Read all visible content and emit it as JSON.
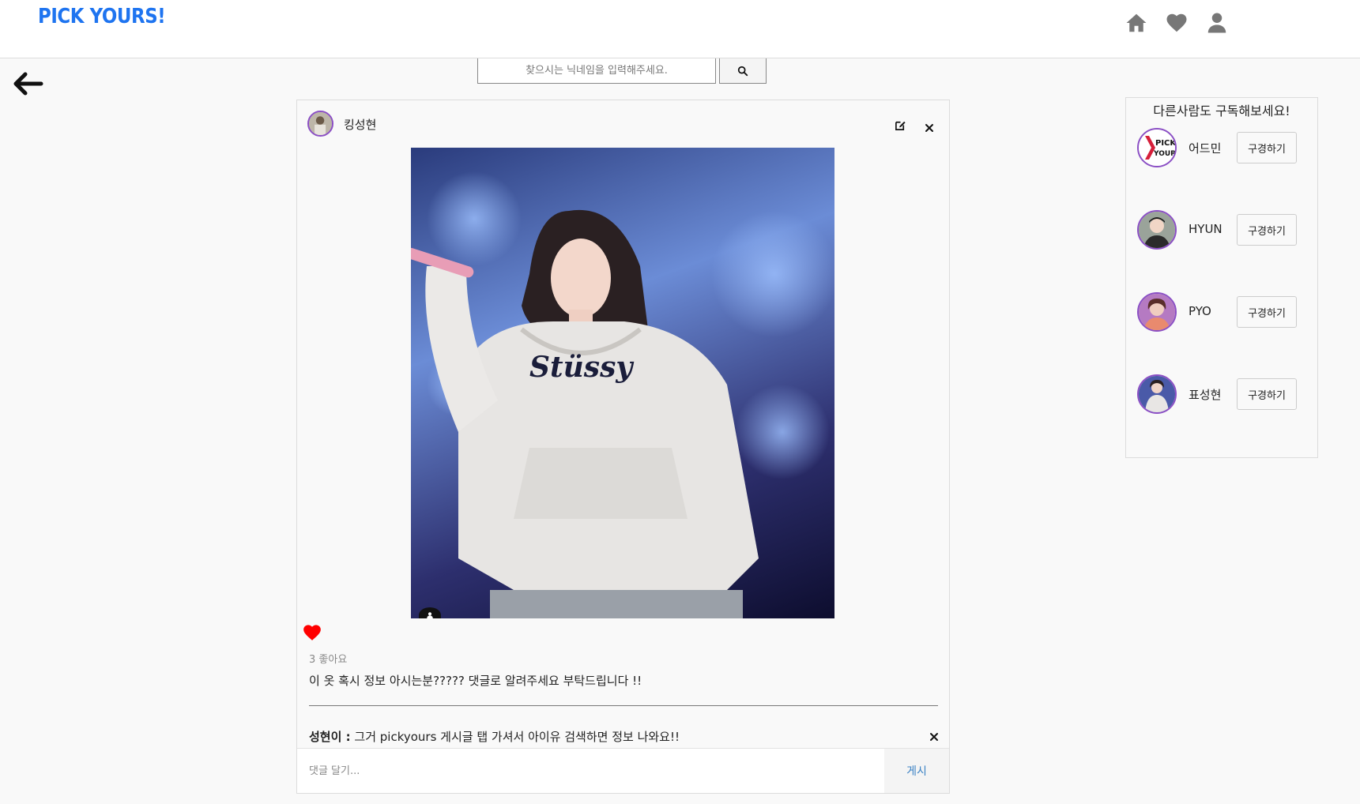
{
  "header": {
    "logo": "PICK YOURS!",
    "nav": [
      {
        "icon": "home-icon"
      },
      {
        "icon": "heart-icon"
      },
      {
        "icon": "user-icon"
      }
    ]
  },
  "search": {
    "placeholder": "찾으시는 닉네임을 입력해주세요.",
    "button_icon": "search-icon"
  },
  "post": {
    "author": "킹성현",
    "image_alt": "아이유 후드티 사진",
    "likes_text": "3 좋아요",
    "caption": "이 옷 혹시 정보 아시는분????? 댓글로 알려주세요 부탁드립니다 !!",
    "comments": [
      {
        "author": "성현이 :",
        "text": " 그거 pickyours 게시글 탭 가셔서 아이유 검색하면 정보 나와요!!"
      }
    ],
    "comment_placeholder": "댓글 달기...",
    "post_button": "게시",
    "liked": true,
    "colors": {
      "heart": "#ff0000",
      "accent": "#8b4fc5",
      "logo": "#1e74f0"
    }
  },
  "sidebar": {
    "title": "다른사람도 구독해보세요!",
    "users": [
      {
        "name": "어드민",
        "button": "구경하기"
      },
      {
        "name": "HYUN",
        "button": "구경하기"
      },
      {
        "name": "PYO",
        "button": "구경하기"
      },
      {
        "name": "표성현",
        "button": "구경하기"
      }
    ]
  }
}
